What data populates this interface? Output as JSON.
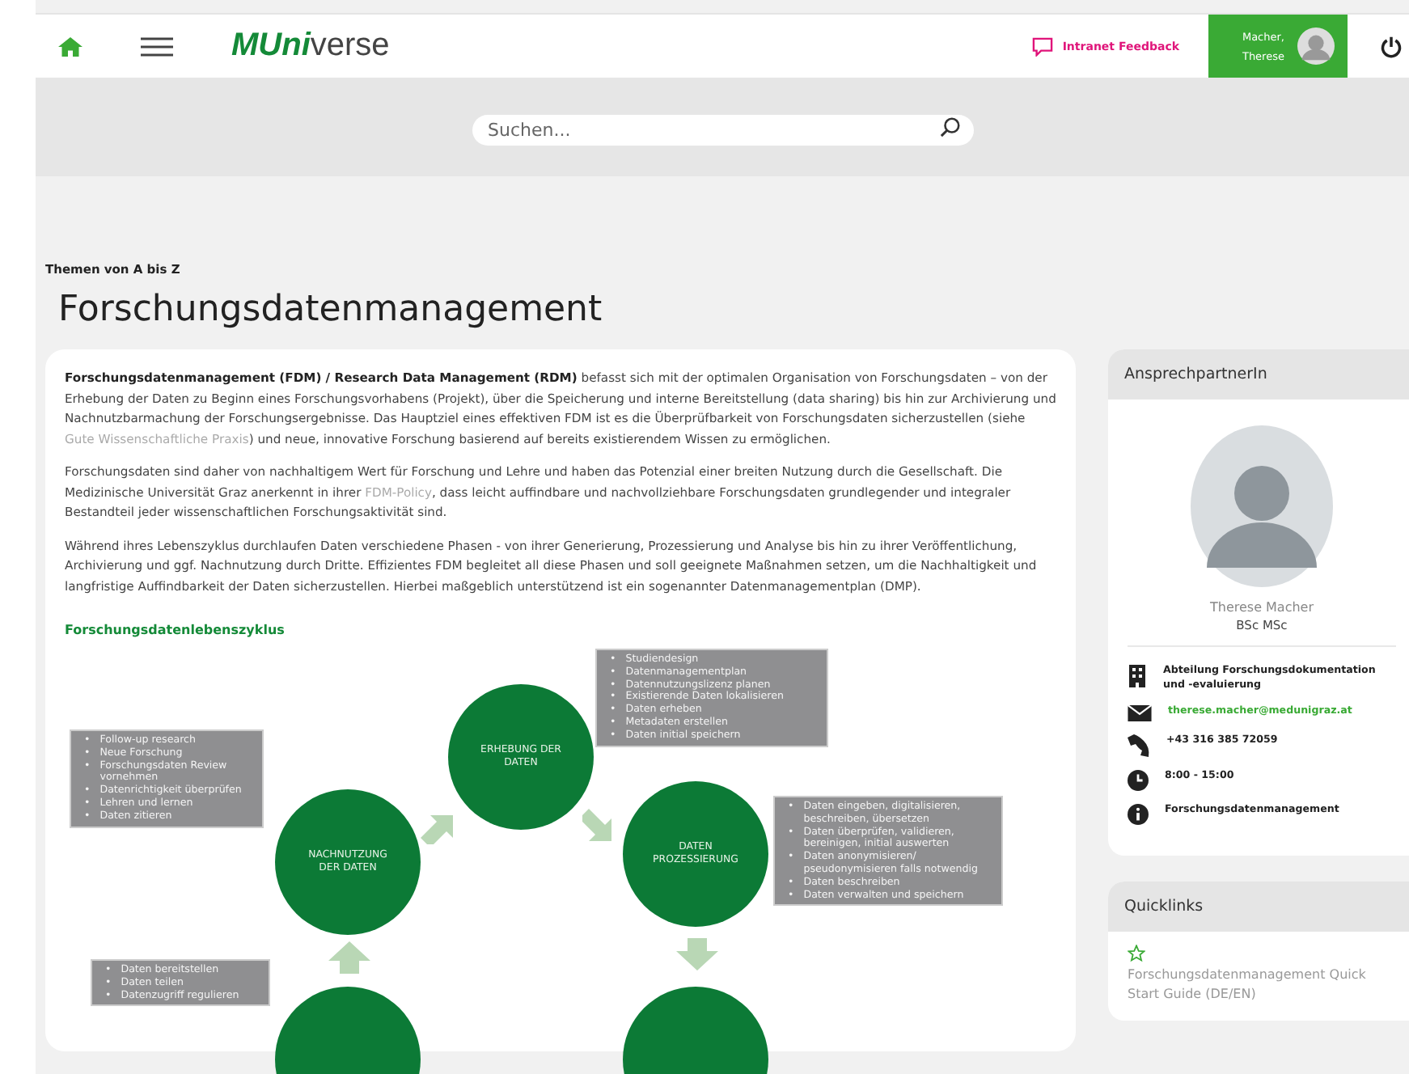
{
  "header": {
    "logo": {
      "prefix": "MUni",
      "suffix": "verse"
    },
    "feedback": "Intranet Feedback",
    "user": {
      "last": "Macher,",
      "first": "Therese"
    }
  },
  "search": {
    "placeholder": "Suchen..."
  },
  "breadcrumb": "Themen von A bis Z",
  "title": "Forschungsdatenmanagement",
  "paragraphs": [
    [
      {
        "kind": "text",
        "text": "**Forschungsdatenmanagement (FDM) / Research Data Management (RDM)** befasst sich mit der optimalen Organisation von Forschungsdaten – von der Erhebung der Daten zu Beginn eines Forschungsvorhabens (Projekt), über die Speicherung und interne Bereitstellung (data sharing) bis hin zur Archivierung und Nachnutzbarmachung der Forschungsergebnisse. Das Hauptziel eines effektiven FDM ist es die Überprüfbarkeit von Forschungsdaten sicherzustellen (siehe"
      },
      {
        "kind": "link",
        "text": "Gute Wissenschaftliche Praxis"
      },
      {
        "kind": "text",
        "text": ") und neue, innovative Forschung basierend auf bereits existierendem Wissen zu ermöglichen."
      }
    ],
    [
      {
        "kind": "text",
        "text": "Forschungsdaten sind daher von nachhaltigem Wert für Forschung und Lehre und haben das Potenzial einer breiten Nutzung durch die Gesellschaft. Die Medizinische Universität Graz anerkennt in ihrer"
      },
      {
        "kind": "link",
        "text": "FDM-Policy"
      },
      {
        "kind": "text",
        "text": ", dass leicht auffindbare und nachvollziehbare Forschungsdaten grundlegender und integraler Bestandteil jeder wissenschaftlichen Forschungsaktivität sind."
      }
    ],
    [
      {
        "kind": "text",
        "text": "Während ihres Lebenszyklus durchlaufen Daten verschiedene Phasen - von ihrer Generierung, Prozessierung und Analyse bis hin zu ihrer Veröffentlichung, Archivierung und ggf. Nachnutzung durch Dritte. Effizientes FDM begleitet all diese Phasen und soll geeignete Maßnahmen setzen, um die Nachhaltigkeit und langfristige Auffindbarkeit der Daten sicherzustellen. Hierbei maßgeblich unterstützend ist ein sogenannter Datenmanagementplan (DMP)."
      }
    ]
  ],
  "lifecycle": {
    "heading": "Forschungsdatenlebenszyklus",
    "bullet": "•",
    "phases": [
      {
        "kind": "circle",
        "label": "ERHEBUNG DER DATEN",
        "items": [
          "Studiendesign",
          "Datenmanagementplan",
          "Datennutzungslizenz planen",
          "Existierende Daten lokalisieren",
          "Daten erheben",
          "Metadaten erstellen",
          "Daten initial speichern"
        ]
      },
      {
        "kind": "circle",
        "label": "DATEN PROZESSIERUNG",
        "items": [
          "Daten eingeben, digitalisieren, beschreiben, übersetzen",
          "Daten überprüfen, validieren, bereinigen, initial auswerten",
          "Daten anonymisieren/ pseudonymisieren falls notwendig",
          "Daten beschreiben",
          "Daten verwalten und speichern"
        ]
      },
      {
        "kind": "circle",
        "label": "NACHNUTZUNG DER DATEN",
        "items": [
          "Follow-up research",
          "Neue Forschung",
          "Forschungsdaten Review vornehmen",
          "Datenrichtigkeit überprüfen",
          "Lehren und lernen",
          "Daten zitieren"
        ]
      },
      {
        "kind": "circle",
        "items": [
          "Daten bereitstellen",
          "Daten teilen",
          "Datenzugriff regulieren"
        ]
      },
      {
        "kind": "circle"
      }
    ]
  },
  "contact": {
    "heading": "AnsprechpartnerIn",
    "name": "Therese Macher",
    "degree": "BSc MSc",
    "rows": [
      {
        "kind": "department",
        "text": "Abteilung Forschungsdokumentation und -evaluierung"
      },
      {
        "kind": "email",
        "text": "therese.macher@medunigraz.at"
      },
      {
        "kind": "phone",
        "text": "+43 316 385 72059"
      },
      {
        "kind": "hours",
        "text": "8:00 - 15:00"
      },
      {
        "kind": "topic",
        "text": "Forschungsdatenmanagement"
      }
    ]
  },
  "quicklinks": {
    "heading": "Quicklinks",
    "items": [
      {
        "text": "Forschungsdatenmanagement Quick Start Guide (DE/EN)"
      }
    ]
  }
}
